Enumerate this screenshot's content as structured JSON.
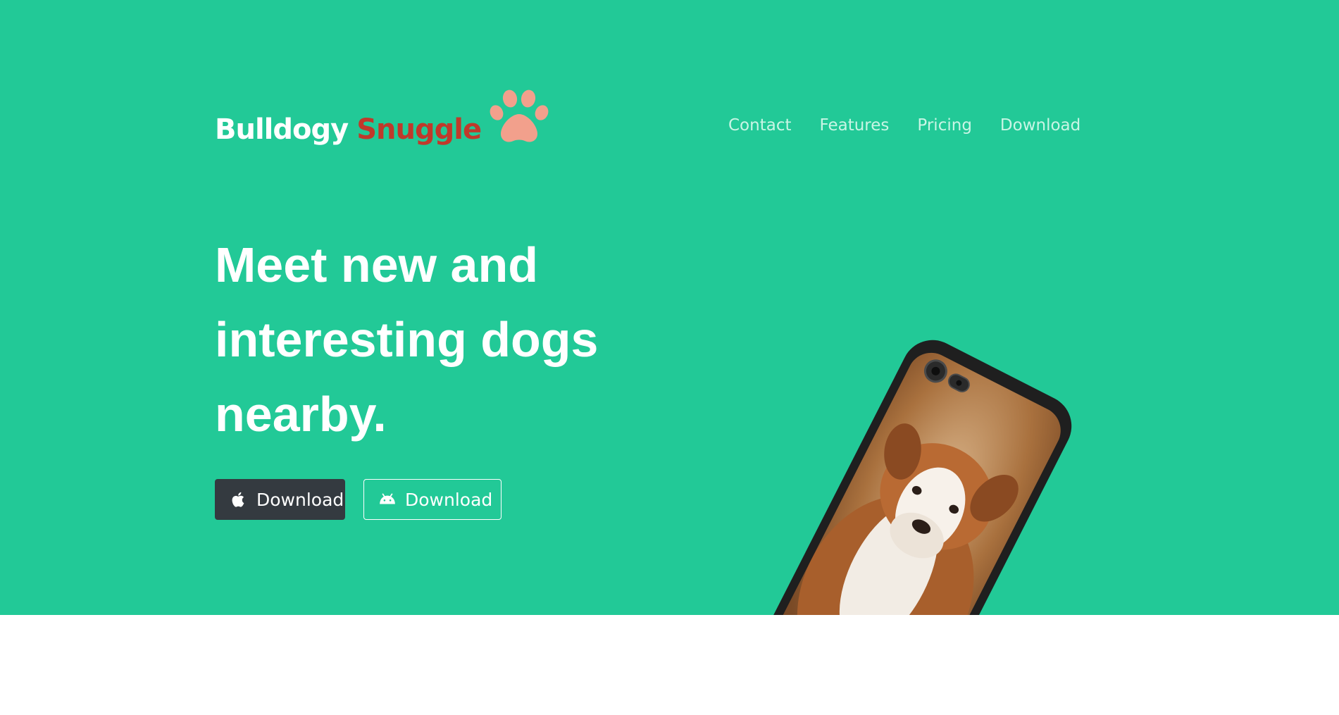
{
  "brand": {
    "name": "Bulldogy",
    "accent": "Snuggle",
    "accent_color": "#c0392b",
    "logo_icon": "paw-icon",
    "logo_color": "#f2a08c"
  },
  "nav": {
    "items": [
      {
        "label": "Contact"
      },
      {
        "label": "Features"
      },
      {
        "label": "Pricing"
      },
      {
        "label": "Download"
      }
    ]
  },
  "hero": {
    "background_color": "#22c997",
    "headline": "Meet new and interesting dogs nearby.",
    "buttons": [
      {
        "label": "Download",
        "icon": "apple-icon",
        "style": "dark"
      },
      {
        "label": "Download",
        "icon": "android-icon",
        "style": "outline"
      }
    ],
    "image": "phone-with-bulldog-puppy"
  }
}
